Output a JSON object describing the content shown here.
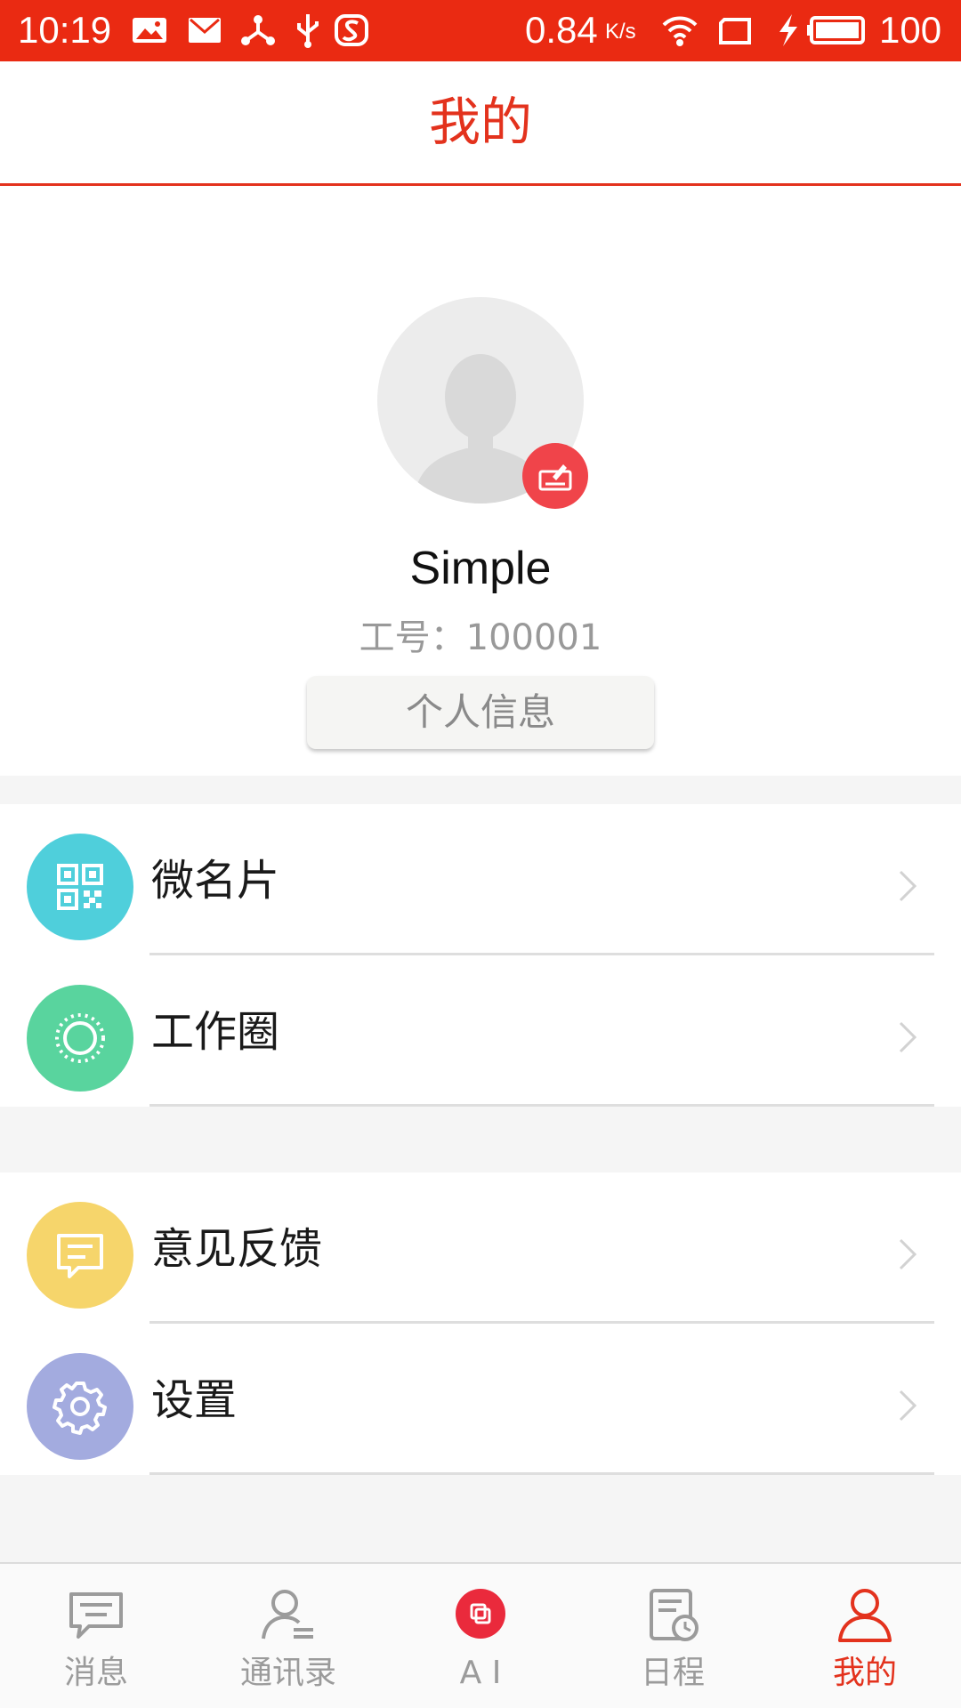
{
  "status_bar": {
    "time": "10:19",
    "speed": "0.84",
    "speed_unit": "K/s",
    "battery": "100",
    "icons": [
      "gallery-icon",
      "mail-icon",
      "share-icon",
      "usb-icon",
      "sogou-icon",
      "wifi-icon",
      "sim-icon",
      "charging-icon",
      "battery-icon"
    ]
  },
  "header": {
    "title": "我的"
  },
  "profile": {
    "name": "Simple",
    "employee_id": "工号：100001",
    "info_button": "个人信息"
  },
  "menu": [
    {
      "label": "微名片",
      "icon": "qr-code-icon",
      "color": "#4fcfdb"
    },
    {
      "label": "工作圈",
      "icon": "circle-icon",
      "color": "#59d49e"
    },
    {
      "label": "意见反馈",
      "icon": "feedback-icon",
      "color": "#f6d56b"
    },
    {
      "label": "设置",
      "icon": "gear-icon",
      "color": "#a3abdf"
    }
  ],
  "bottom_nav": [
    {
      "label": "消息",
      "icon": "message-icon",
      "active": false
    },
    {
      "label": "通讯录",
      "icon": "contacts-icon",
      "active": false
    },
    {
      "label": "A I",
      "icon": "ai-icon",
      "active": false
    },
    {
      "label": "日程",
      "icon": "schedule-icon",
      "active": false
    },
    {
      "label": "我的",
      "icon": "profile-icon",
      "active": true
    }
  ],
  "colors": {
    "brand_red": "#e3321d",
    "status_bar": "#ea2a12",
    "inactive": "#9b9b9b"
  }
}
